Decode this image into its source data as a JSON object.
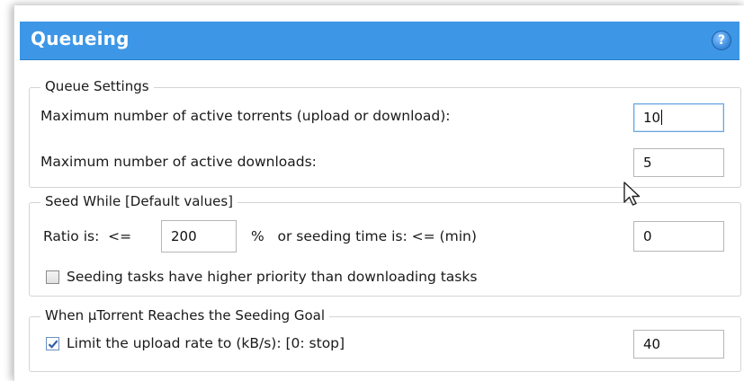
{
  "panel": {
    "title": "Queueing",
    "help_icon": "question-mark-icon"
  },
  "queue_settings": {
    "legend": "Queue Settings",
    "max_active_torrents_label": "Maximum number of active torrents (upload or download):",
    "max_active_torrents_value": "10",
    "max_active_downloads_label": "Maximum number of active downloads:",
    "max_active_downloads_value": "5"
  },
  "seed_while": {
    "legend": "Seed While [Default values]",
    "ratio_label": "Ratio is:  <=",
    "ratio_value": "200",
    "ratio_suffix": "%   or seeding time is: <= (min)",
    "seeding_time_value": "0",
    "priority_checkbox_label": "Seeding tasks have higher priority than downloading tasks",
    "priority_checked": false
  },
  "seeding_goal": {
    "legend": "When µTorrent Reaches the Seeding Goal",
    "limit_upload_label": "Limit the upload rate to (kB/s): [0: stop]",
    "limit_upload_checked": true,
    "limit_upload_value": "40"
  },
  "colors": {
    "header_bg": "#3d97e6",
    "header_text": "#ffffff",
    "group_border": "#d4d4d4"
  }
}
